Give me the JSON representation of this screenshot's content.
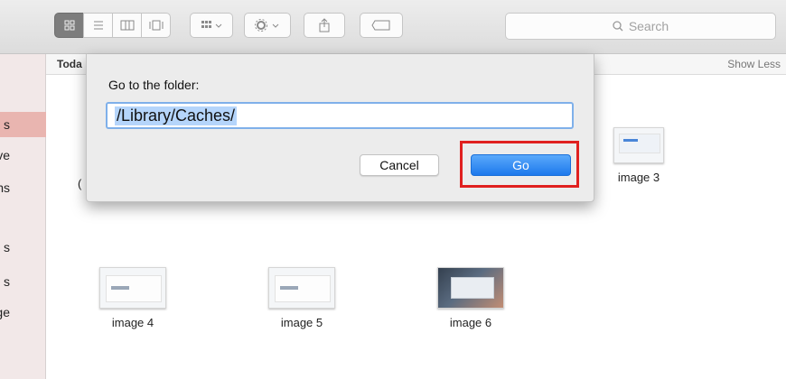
{
  "toolbar": {
    "view_buttons": [
      "icon-view",
      "list-view",
      "column-view",
      "gallery-view"
    ],
    "arrange_label": "arrange-menu",
    "action_label": "action-menu",
    "share_icon": "share-icon",
    "tag_icon": "tag-icon",
    "search_placeholder": "Search"
  },
  "sidebar": {
    "items": [
      {
        "label": "s",
        "selected": true
      },
      {
        "label": "ve",
        "selected": false
      },
      {
        "label": "ns",
        "selected": false
      },
      {
        "label": "s",
        "selected": false
      },
      {
        "label": "s",
        "selected": false
      },
      {
        "label": "age",
        "selected": false
      }
    ]
  },
  "list_header": {
    "section": "Toda",
    "toggle": "Show Less"
  },
  "files": [
    {
      "name": "image 3"
    },
    {
      "name": "image 4"
    },
    {
      "name": "image 5"
    },
    {
      "name": "image 6"
    }
  ],
  "partial_label": "(",
  "dialog": {
    "title": "Go to the folder:",
    "path_value": "/Library/Caches/",
    "cancel_label": "Cancel",
    "go_label": "Go"
  },
  "colors": {
    "accent": "#1d79ec",
    "highlight_outline": "#e0201f",
    "selection": "#b5d5fb"
  }
}
